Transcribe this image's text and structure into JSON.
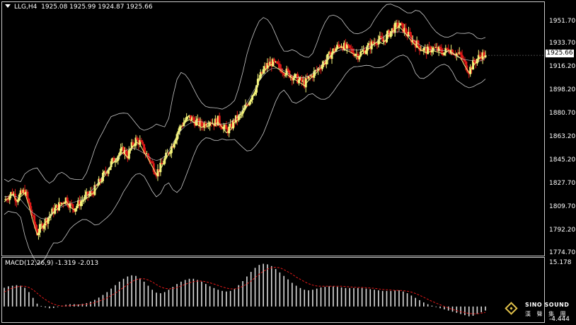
{
  "header": {
    "symbol": "LLG,H4",
    "ohlc": "1925.08 1925.99 1924.87 1925.66"
  },
  "macd": {
    "label": "MACD(12,26,9) -1.319 -2.013",
    "axis_top": "15.178",
    "axis_bottom": "-4.444"
  },
  "current_price": "1925.66",
  "price_axis": [
    "1951.70",
    "1933.70",
    "1916.20",
    "1898.20",
    "1880.70",
    "1863.20",
    "1845.20",
    "1827.70",
    "1809.70",
    "1792.20",
    "1774.70"
  ],
  "logo": {
    "name": "SINO SOUND",
    "sub": "漢 聲 集 團"
  },
  "colors": {
    "bull": "#f5f57a",
    "bear": "#e01818",
    "ma": "#f0f080",
    "band": "#c8c8c8",
    "signal": "#e01818",
    "hist": "#dcdcdc"
  },
  "chart_data": {
    "type": "candlestick",
    "symbol": "LLG",
    "timeframe": "H4",
    "ylim": [
      1774.7,
      1958
    ],
    "indicators": [
      "Bollinger Bands",
      "Moving Average",
      "MACD(12,26,9)"
    ],
    "close_path": [
      1815,
      1818,
      1821,
      1816,
      1819,
      1822,
      1812,
      1800,
      1790,
      1795,
      1799,
      1803,
      1807,
      1810,
      1813,
      1816,
      1811,
      1809,
      1812,
      1815,
      1818,
      1820,
      1823,
      1828,
      1833,
      1838,
      1843,
      1847,
      1851,
      1853,
      1849,
      1856,
      1861,
      1859,
      1853,
      1848,
      1842,
      1836,
      1840,
      1846,
      1852,
      1858,
      1866,
      1872,
      1876,
      1878,
      1876,
      1874,
      1872,
      1874,
      1876,
      1874,
      1876,
      1872,
      1868,
      1870,
      1876,
      1878,
      1882,
      1888,
      1894,
      1900,
      1908,
      1914,
      1918,
      1920,
      1918,
      1916,
      1914,
      1912,
      1910,
      1908,
      1906,
      1904,
      1908,
      1911,
      1914,
      1918,
      1921,
      1925,
      1929,
      1932,
      1934,
      1931,
      1930,
      1928,
      1926,
      1928,
      1931,
      1933,
      1936,
      1938,
      1936,
      1940,
      1944,
      1947,
      1949,
      1946,
      1942,
      1938,
      1935,
      1932,
      1930,
      1929,
      1931,
      1930,
      1929,
      1928,
      1931,
      1929,
      1927,
      1925,
      1919,
      1914,
      1919,
      1923,
      1926,
      1925.66
    ],
    "macd_hist": [
      6.5,
      7,
      7.2,
      7.4,
      7.2,
      6.5,
      5,
      3,
      1,
      0.2,
      -0.3,
      -0.6,
      -0.5,
      -0.2,
      0.3,
      0.6,
      0.8,
      0.8,
      0.7,
      0.9,
      1.2,
      1.7,
      2.3,
      3.1,
      4,
      5,
      6.2,
      7.4,
      8.6,
      9.6,
      10.4,
      10.8,
      10.6,
      9.8,
      8.6,
      7.2,
      5.8,
      4.8,
      4.6,
      5,
      5.8,
      6.8,
      7.8,
      8.6,
      9.2,
      9.6,
      9.6,
      9.2,
      8.6,
      7.8,
      7,
      6.4,
      5.8,
      5.4,
      5.2,
      5.4,
      6.2,
      7.4,
      8.8,
      10.4,
      12,
      13.4,
      14.4,
      14.8,
      14.6,
      14,
      13,
      11.8,
      10.6,
      9.4,
      8.2,
      7.2,
      6.4,
      5.8,
      5.6,
      5.8,
      6.2,
      6.6,
      6.8,
      7,
      7,
      6.8,
      6.6,
      6.4,
      6.4,
      6.4,
      6.4,
      6.4,
      6.2,
      6,
      5.8,
      5.6,
      5.4,
      5.4,
      5.4,
      5.6,
      5.6,
      5.2,
      4.6,
      3.8,
      3,
      2.2,
      1.4,
      0.8,
      0.3,
      -0.2,
      -0.6,
      -1,
      -1.4,
      -1.8,
      -2.2,
      -2.6,
      -3,
      -3.4,
      -3.2,
      -2.6,
      -2,
      -1.4
    ],
    "macd_signal": [
      5,
      5.8,
      6.4,
      6.8,
      7,
      7,
      6.6,
      5.8,
      4.6,
      3.4,
      2.4,
      1.5,
      0.8,
      0.4,
      0.2,
      0.2,
      0.3,
      0.4,
      0.5,
      0.6,
      0.8,
      1,
      1.4,
      1.8,
      2.4,
      3,
      3.8,
      4.6,
      5.6,
      6.6,
      7.6,
      8.6,
      9.3,
      9.6,
      9.6,
      9.2,
      8.5,
      7.6,
      6.8,
      6.3,
      6.1,
      6.2,
      6.6,
      7.1,
      7.7,
      8.2,
      8.6,
      8.8,
      8.8,
      8.6,
      8.2,
      7.8,
      7.3,
      6.8,
      6.4,
      6.1,
      6.1,
      6.4,
      7,
      7.8,
      8.8,
      10,
      11.2,
      12.2,
      13,
      13.4,
      13.6,
      13.4,
      12.8,
      12,
      11.2,
      10.2,
      9.4,
      8.6,
      7.9,
      7.4,
      7.1,
      7,
      7,
      7,
      7,
      7,
      7,
      6.9,
      6.8,
      6.7,
      6.6,
      6.6,
      6.5,
      6.4,
      6.3,
      6.1,
      5.9,
      5.8,
      5.7,
      5.6,
      5.6,
      5.5,
      5.3,
      5,
      4.5,
      3.9,
      3.2,
      2.5,
      1.8,
      1.2,
      0.6,
      0,
      -0.5,
      -1,
      -1.4,
      -1.8,
      -2.1,
      -2.4,
      -2.5,
      -2.5,
      -2.3,
      -2.013
    ]
  }
}
